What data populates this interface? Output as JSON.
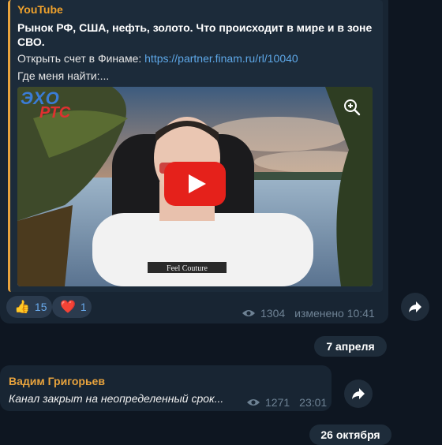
{
  "post": {
    "preview": {
      "source": "YouTube",
      "title": "Рынок РФ, США, нефть, золото. Что происходит в мире и в зоне СВО.",
      "open_account_text": "Открыть счет в Финаме: ",
      "open_account_link": "https://partner.finam.ru/rl/10040",
      "where_text": "Где меня найти:...",
      "logo_top": "ЭХО",
      "logo_bottom": "РТС",
      "shirt_text": "Feel Couture"
    },
    "reactions": [
      {
        "emoji": "👍",
        "count": "15"
      },
      {
        "emoji": "❤️",
        "count": "1"
      }
    ],
    "views": "1304",
    "edited_label": "изменено 10:41"
  },
  "date_separators": [
    "7 апреля",
    "26 октября"
  ],
  "message2": {
    "author": "Вадим Григорьев",
    "text": "Канал закрыт на неопределенный срок...",
    "views": "1271",
    "time": "23:01"
  },
  "colors": {
    "background": "#0e1621",
    "bubble": "#182533",
    "accent_orange": "#e8a33d",
    "link": "#5ea8e8",
    "muted": "#6e8294"
  },
  "icons": [
    "zoom-in-icon",
    "play-icon",
    "eye-icon",
    "forward-icon"
  ]
}
